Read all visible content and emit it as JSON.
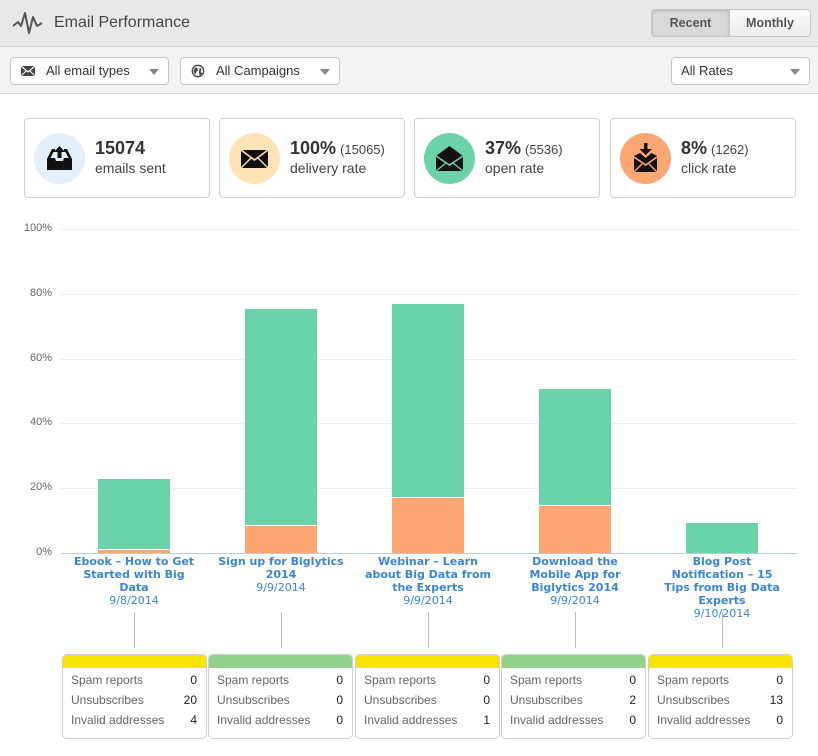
{
  "header": {
    "title": "Email Performance",
    "icon": "activity-pulse-icon",
    "view_toggle": [
      {
        "label": "Recent",
        "active": true
      },
      {
        "label": "Monthly",
        "active": false
      }
    ]
  },
  "filters": {
    "email_types": {
      "icon": "envelope-icon",
      "value": "All email types"
    },
    "campaigns": {
      "icon": "globe-icon",
      "value": "All Campaigns"
    },
    "rates": {
      "value": "All Rates"
    }
  },
  "stats": [
    {
      "icon": "inbox-upload-icon",
      "value": "15074",
      "count": "",
      "label": "emails sent",
      "color": "#e3effa"
    },
    {
      "icon": "envelope-closed-icon",
      "value": "100%",
      "count": "(15065)",
      "label": "delivery rate",
      "color": "#fde3b5"
    },
    {
      "icon": "envelope-open-icon",
      "value": "37%",
      "count": "(5536)",
      "label": "open rate",
      "color": "#6bd3aa"
    },
    {
      "icon": "envelope-download-icon",
      "value": "8%",
      "count": "(1262)",
      "label": "click rate",
      "color": "#fca673"
    }
  ],
  "chart_data": {
    "type": "bar",
    "title": "",
    "xlabel": "",
    "ylabel": "",
    "ylim": [
      0,
      100
    ],
    "y_ticks": [
      "0%",
      "20%",
      "40%",
      "60%",
      "80%",
      "100%"
    ],
    "grid": true,
    "categories": [
      {
        "name": "Ebook - How to Get Started with Big Data",
        "date": "9/8/2014"
      },
      {
        "name": "Sign up for Biglytics 2014",
        "date": "9/9/2014"
      },
      {
        "name": "Webinar - Learn about Big Data from the Experts",
        "date": "9/9/2014"
      },
      {
        "name": "Download the Mobile App for Biglytics 2014",
        "date": "9/9/2014"
      },
      {
        "name": "Blog Post Notification - 15 Tips from Big Data Experts",
        "date": "9/10/2014"
      }
    ],
    "series": [
      {
        "name": "Open rate",
        "color": "#6bd3aa",
        "values": [
          22.8,
          75.3,
          76.9,
          50.6,
          9.3
        ]
      },
      {
        "name": "Click rate",
        "color": "#fca673",
        "values": [
          1.3,
          8.6,
          17.3,
          14.8,
          0
        ]
      }
    ]
  },
  "detail_cards": [
    {
      "status_color": "#f7e400",
      "spam_reports": "0",
      "unsubscribes": "20",
      "invalid_addresses": "4"
    },
    {
      "status_color": "#92d38a",
      "spam_reports": "0",
      "unsubscribes": "0",
      "invalid_addresses": "0"
    },
    {
      "status_color": "#f7e400",
      "spam_reports": "0",
      "unsubscribes": "0",
      "invalid_addresses": "1"
    },
    {
      "status_color": "#92d38a",
      "spam_reports": "0",
      "unsubscribes": "2",
      "invalid_addresses": "0"
    },
    {
      "status_color": "#f7e400",
      "spam_reports": "0",
      "unsubscribes": "13",
      "invalid_addresses": "0"
    }
  ],
  "detail_labels": {
    "spam_reports": "Spam reports",
    "unsubscribes": "Unsubscribes",
    "invalid_addresses": "Invalid addresses"
  }
}
